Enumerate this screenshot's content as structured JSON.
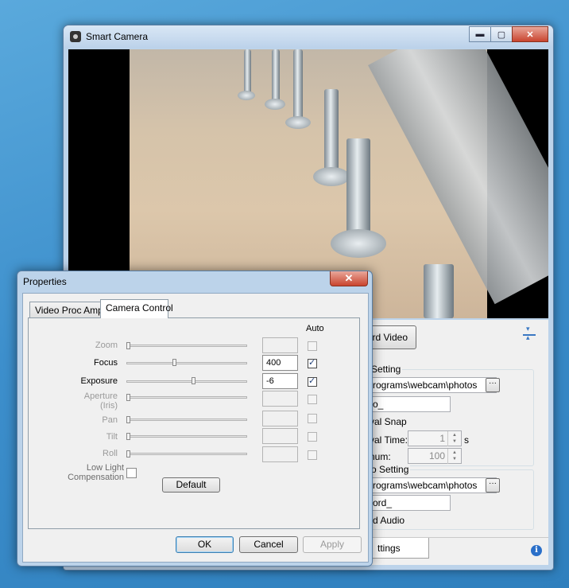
{
  "main": {
    "title": "Smart Camera",
    "caption": {
      "minimize": "▬",
      "maximize": "▢",
      "close": "✕"
    },
    "record_video": "rd Video",
    "photo_group": {
      "title": "Setting",
      "path": "rograms\\webcam\\photos",
      "prefix": "o_",
      "interval_snap": "val Snap",
      "interval_time_label": "val Time:",
      "interval_time_value": "1",
      "interval_unit": "s",
      "maximum_label": "num:",
      "maximum_value": "100"
    },
    "video_group": {
      "title": "o Setting",
      "path": "rograms\\webcam\\photos",
      "prefix": "ord_",
      "record_audio": "rd Audio"
    },
    "browse": "···",
    "settings_tab": "ttings",
    "info": "i"
  },
  "dialog": {
    "title": "Properties",
    "close": "✕",
    "tabs": [
      "Video Proc Amp",
      "Camera Control"
    ],
    "auto_header": "Auto",
    "rows": [
      {
        "label": "Zoom",
        "value": "",
        "enabled": false,
        "auto": false,
        "thumb": 0.0
      },
      {
        "label": "Focus",
        "value": "400",
        "enabled": true,
        "auto": true,
        "thumb": 0.39
      },
      {
        "label": "Exposure",
        "value": "-6",
        "enabled": true,
        "auto": true,
        "thumb": 0.55
      },
      {
        "label": "Aperture\n(Iris)",
        "value": "",
        "enabled": false,
        "auto": false,
        "thumb": 0.0
      },
      {
        "label": "Pan",
        "value": "",
        "enabled": false,
        "auto": false,
        "thumb": 0.0
      },
      {
        "label": "Tilt",
        "value": "",
        "enabled": false,
        "auto": false,
        "thumb": 0.0
      },
      {
        "label": "Roll",
        "value": "",
        "enabled": false,
        "auto": false,
        "thumb": 0.0
      }
    ],
    "low_light_label": "Low Light\nCompensation",
    "default_button": "Default",
    "ok_button": "OK",
    "cancel_button": "Cancel",
    "apply_button": "Apply"
  }
}
